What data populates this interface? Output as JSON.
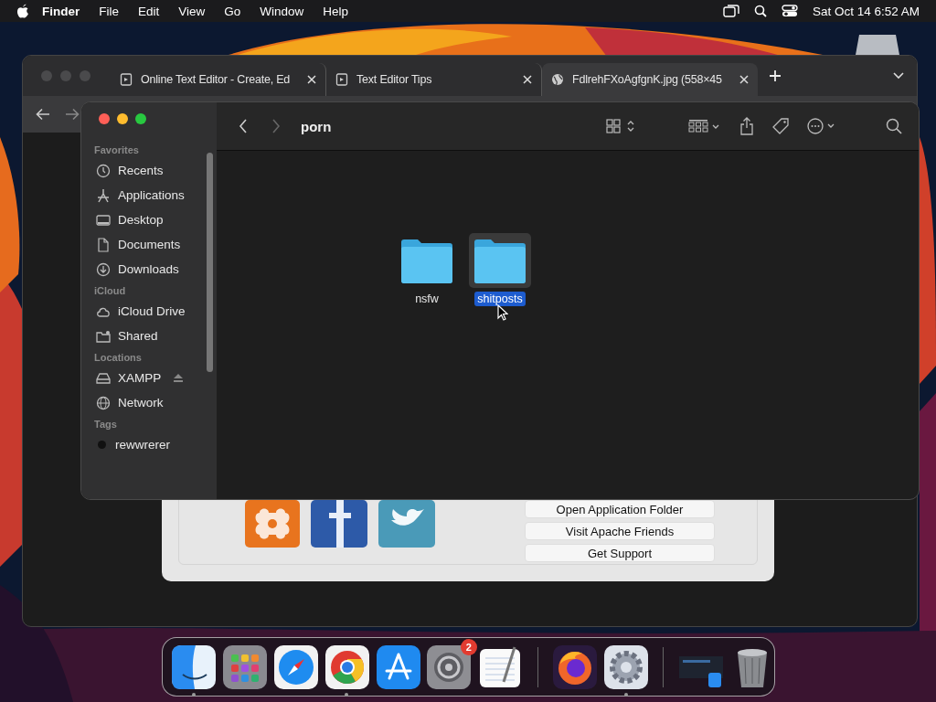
{
  "menu_bar": {
    "app_name": "Finder",
    "menus": [
      "File",
      "Edit",
      "View",
      "Go",
      "Window",
      "Help"
    ],
    "clock": "Sat Oct 14  6:52 AM"
  },
  "browser": {
    "tabs": [
      {
        "title": "Online Text Editor - Create, Ed",
        "kind": "page",
        "selected": false
      },
      {
        "title": "Text Editor Tips",
        "kind": "page",
        "selected": false
      },
      {
        "title": "FdlrehFXoAgfgnK.jpg (558×45",
        "kind": "globe",
        "selected": true
      }
    ]
  },
  "xampp_panel": {
    "buttons": [
      "Open Application Folder",
      "Visit Apache Friends",
      "Get Support"
    ]
  },
  "finder": {
    "title": "porn",
    "sidebar": [
      {
        "heading": "Favorites",
        "items": [
          {
            "label": "Recents",
            "kind": "clock",
            "ejectable": false
          },
          {
            "label": "Applications",
            "kind": "apps",
            "ejectable": false
          },
          {
            "label": "Desktop",
            "kind": "desktop",
            "ejectable": false
          },
          {
            "label": "Documents",
            "kind": "document",
            "ejectable": false
          },
          {
            "label": "Downloads",
            "kind": "download",
            "ejectable": false
          }
        ]
      },
      {
        "heading": "iCloud",
        "items": [
          {
            "label": "iCloud Drive",
            "kind": "cloud",
            "ejectable": false
          },
          {
            "label": "Shared",
            "kind": "shared",
            "ejectable": false
          }
        ]
      },
      {
        "heading": "Locations",
        "items": [
          {
            "label": "XAMPP",
            "kind": "drive",
            "ejectable": true
          },
          {
            "label": "Network",
            "kind": "globe",
            "ejectable": false
          }
        ]
      },
      {
        "heading": "Tags",
        "items": [
          {
            "label": "rewwrerer",
            "kind": "tag",
            "color": "#111111",
            "ejectable": false
          }
        ]
      }
    ],
    "items": [
      {
        "name": "nsfw",
        "selected": false
      },
      {
        "name": "shitposts",
        "selected": true
      }
    ]
  },
  "dock": {
    "apps": [
      {
        "kind": "finder",
        "running": true
      },
      {
        "kind": "launchpad",
        "running": false
      },
      {
        "kind": "safari",
        "running": false
      },
      {
        "kind": "chrome",
        "running": true
      },
      {
        "kind": "appstore",
        "running": false
      },
      {
        "kind": "settings",
        "running": false,
        "badge": "2"
      },
      {
        "kind": "textedit",
        "running": false
      },
      {
        "kind": "separator"
      },
      {
        "kind": "firefox",
        "running": false
      },
      {
        "kind": "gear",
        "running": true
      },
      {
        "kind": "separator"
      },
      {
        "kind": "window",
        "running": false
      },
      {
        "kind": "trash",
        "running": false
      }
    ]
  }
}
